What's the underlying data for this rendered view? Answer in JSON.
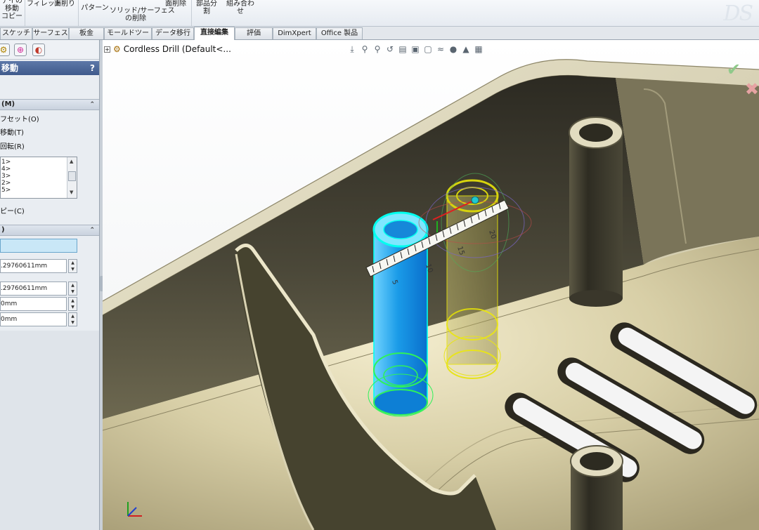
{
  "ribbon": {
    "items": [
      "デイの\n移動\nコピー",
      "フィレット",
      "面削り",
      "パターン",
      "ソリッド/サーフェス\nの削除",
      "面削除",
      "部品分\n割",
      "組み合わ\nせ"
    ]
  },
  "tabs": [
    "スケッチ",
    "サーフェス",
    "板金",
    "モールドツール",
    "データ移行",
    "直接編集",
    "評価",
    "DimXpert",
    "Office 製品"
  ],
  "left_panel": {
    "title": "移動",
    "help": "?",
    "section1": "(M)",
    "options": [
      "フセット(O)",
      "移動(T)",
      "回転(R)"
    ],
    "list_items": [
      "1>",
      "4>",
      "3>",
      "2>",
      "5>"
    ],
    "copy_option": "ピー(C)",
    "section2": ")",
    "field_values": [
      ".29760611mm",
      ".29760611mm",
      "0mm",
      "0mm"
    ]
  },
  "viewport": {
    "tree_label": "Cordless Drill  (Default<..."
  },
  "ruler": {
    "labels": [
      "5",
      "10",
      "15",
      "20"
    ]
  },
  "colors": {
    "housing": "#d5cfb3",
    "selected_boss": "#21a7ef",
    "ghost_boss": "#d7d20f"
  }
}
